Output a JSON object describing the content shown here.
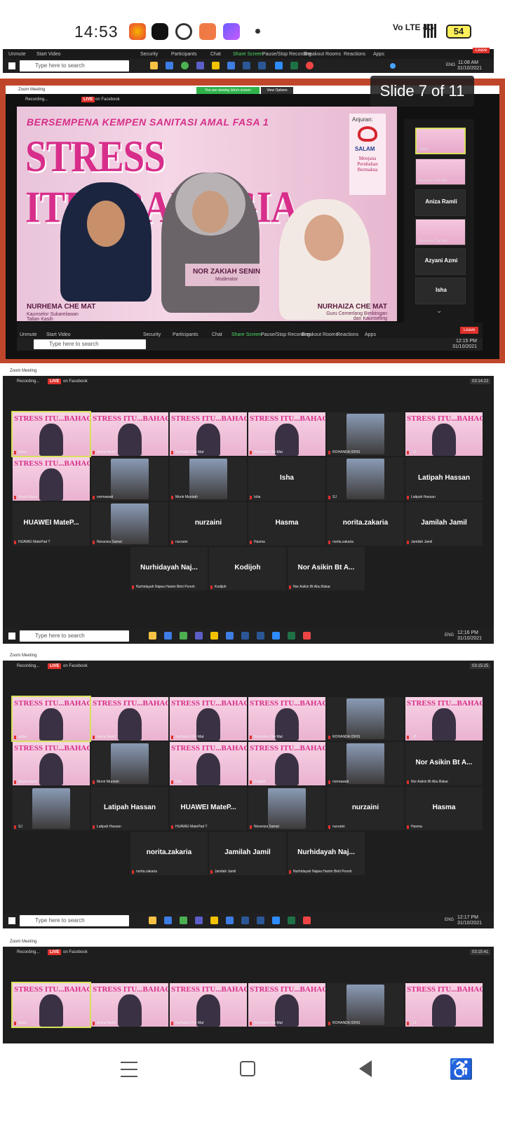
{
  "status_bar": {
    "time": "14:53",
    "signal_text": "Vo LTE 4G",
    "battery": "54"
  },
  "top_toolbar": {
    "items": [
      "Unmute",
      "Start Video",
      "Security",
      "Participants",
      "Chat",
      "Share Screen",
      "Pause/Stop Recording",
      "Breakout Rooms",
      "Reactions",
      "Apps"
    ],
    "leave": "Leave",
    "clock": "11:08 AM\n31/10/2021"
  },
  "taskbar": {
    "search_placeholder": "Type here to search",
    "lang": "ENG"
  },
  "shot1": {
    "window_title": "Zoom Meeting",
    "viewing": "You are viewing Isha's screen",
    "view_options": "View Options",
    "recording": "Recording...",
    "live": "LIVE",
    "on_facebook": "on Facebook",
    "slide_badge": "Slide 7 of 11",
    "banner": {
      "subtitle": "BERSEMPENA KEMPEN SANITASI AMAL FASA 1",
      "title": "STRESS ITU...BAHAGIA",
      "anjuran": "Anjuran:",
      "logo": "SALAM",
      "tagline": "Menjana Perubahan Bermakna",
      "p1_name": "NURHEMA CHE MAT",
      "p1_role": "Kaunselor Sukarelawan Talian Kasih",
      "p2_name": "NOR ZAKIAH SENIN",
      "p2_role": "Moderator",
      "p3_name": "NURHAIZA CHE MAT",
      "p3_role": "Guru Cemerlang Bimbingan dan Kaunseling"
    },
    "side": [
      "aizira",
      "Nurhaiza Che Mat",
      "Aniza Ramli",
      "Nurhema Che Mat",
      "Azyani Azmi",
      "Isha"
    ],
    "clock": "12:15 PM\n31/10/2021"
  },
  "shot2": {
    "window_title": "Zoom Meeting",
    "timer": "03:14:22",
    "rows": [
      [
        {
          "type": "pink",
          "name": "aizira"
        },
        {
          "type": "pink",
          "name": "Aniza Ramli"
        },
        {
          "type": "pink",
          "name": "Nurhaiza Che Mat"
        },
        {
          "type": "pink",
          "name": "Nurhema Che Mat"
        },
        {
          "type": "photo",
          "name": "ROHANDA IDRIS"
        },
        {
          "type": "pink",
          "name": "- IZ -"
        }
      ],
      [
        {
          "type": "pink",
          "name": "Azyani Azmi"
        },
        {
          "type": "photo",
          "name": "normawati"
        },
        {
          "type": "photo",
          "name": "Munir Munirah"
        },
        {
          "type": "text",
          "name": "Isha",
          "label": "Isha"
        },
        {
          "type": "photo",
          "name": "SJ"
        },
        {
          "type": "text",
          "name": "Latipah Hassan",
          "label": "Latipah Hassan"
        }
      ],
      [
        {
          "type": "text",
          "name": "HUAWEI MatePad T",
          "label": "HUAWEI  MateP..."
        },
        {
          "type": "photo",
          "name": "Noraniza Samat"
        },
        {
          "type": "text",
          "name": "nurzaini",
          "label": "nurzaini"
        },
        {
          "type": "text",
          "name": "Hasma",
          "label": "Hasma"
        },
        {
          "type": "text",
          "name": "norita.zakaria",
          "label": "norita.zakaria"
        },
        {
          "type": "text",
          "name": "Jamilah Jamil",
          "label": "Jamilah Jamil"
        }
      ],
      [
        {
          "type": "text",
          "name": "Nurhidayah Najwa Hanim Binti Ponoh",
          "label": "Nurhidayah  Naj..."
        },
        {
          "type": "text",
          "name": "Kodijoh",
          "label": "Kodijoh"
        },
        {
          "type": "text",
          "name": "Nor Asikin Bt Abu Bakar",
          "label": "Nor Asikin Bt A..."
        }
      ]
    ],
    "clock": "12:16 PM\n31/10/2021"
  },
  "shot3": {
    "window_title": "Zoom Meeting",
    "timer": "03:15:25",
    "rows": [
      [
        {
          "type": "pink",
          "name": "aizira"
        },
        {
          "type": "pink",
          "name": "Aniza Ramli"
        },
        {
          "type": "pink",
          "name": "Nurhaiza Che Mat"
        },
        {
          "type": "pink",
          "name": "Nurhema Che Mat"
        },
        {
          "type": "photo",
          "name": "ROHANDA IDRIS"
        },
        {
          "type": "pink",
          "name": "- IZ -"
        }
      ],
      [
        {
          "type": "pink",
          "name": "Azyani Azmi"
        },
        {
          "type": "photo",
          "name": "Munir Munirah"
        },
        {
          "type": "pink",
          "name": "Isha"
        },
        {
          "type": "pink",
          "name": "Kodijoh"
        },
        {
          "type": "photo",
          "name": "normawati"
        },
        {
          "type": "text",
          "name": "Nor Asikin Bt Abu Bakar",
          "label": "Nor Asikin Bt A..."
        }
      ],
      [
        {
          "type": "photo",
          "name": "SJ"
        },
        {
          "type": "text",
          "name": "Latipah Hassan",
          "label": "Latipah Hassan"
        },
        {
          "type": "text",
          "name": "HUAWEI MatePad T",
          "label": "HUAWEI  MateP..."
        },
        {
          "type": "photo",
          "name": "Noraniza Samat"
        },
        {
          "type": "text",
          "name": "nurzaini",
          "label": "nurzaini"
        },
        {
          "type": "text",
          "name": "Hasma",
          "label": "Hasma"
        }
      ],
      [
        {
          "type": "text",
          "name": "norita.zakaria",
          "label": "norita.zakaria"
        },
        {
          "type": "text",
          "name": "Jamilah Jamil",
          "label": "Jamilah Jamil"
        },
        {
          "type": "text",
          "name": "Nurhidayah Najwa Hanim Binti Ponoh",
          "label": "Nurhidayah  Naj..."
        }
      ]
    ],
    "clock": "12:17 PM\n31/10/2021"
  },
  "shot4": {
    "window_title": "Zoom Meeting",
    "timer": "03:15:41",
    "rows": [
      [
        {
          "type": "pink",
          "name": "aizira"
        },
        {
          "type": "pink",
          "name": "Aniza Ramli"
        },
        {
          "type": "pink",
          "name": "Nurhaiza Che Mat"
        },
        {
          "type": "pink",
          "name": "Nurhema Che Mat"
        },
        {
          "type": "photo",
          "name": "ROHANDA IDRIS"
        },
        {
          "type": "pink",
          "name": "- IZ -"
        }
      ]
    ]
  },
  "tile_title": "STRESS ITU...BAHAGIA",
  "colors": {
    "accent": "#d62e88",
    "live": "#e0302a",
    "frame": "#c0462b"
  }
}
